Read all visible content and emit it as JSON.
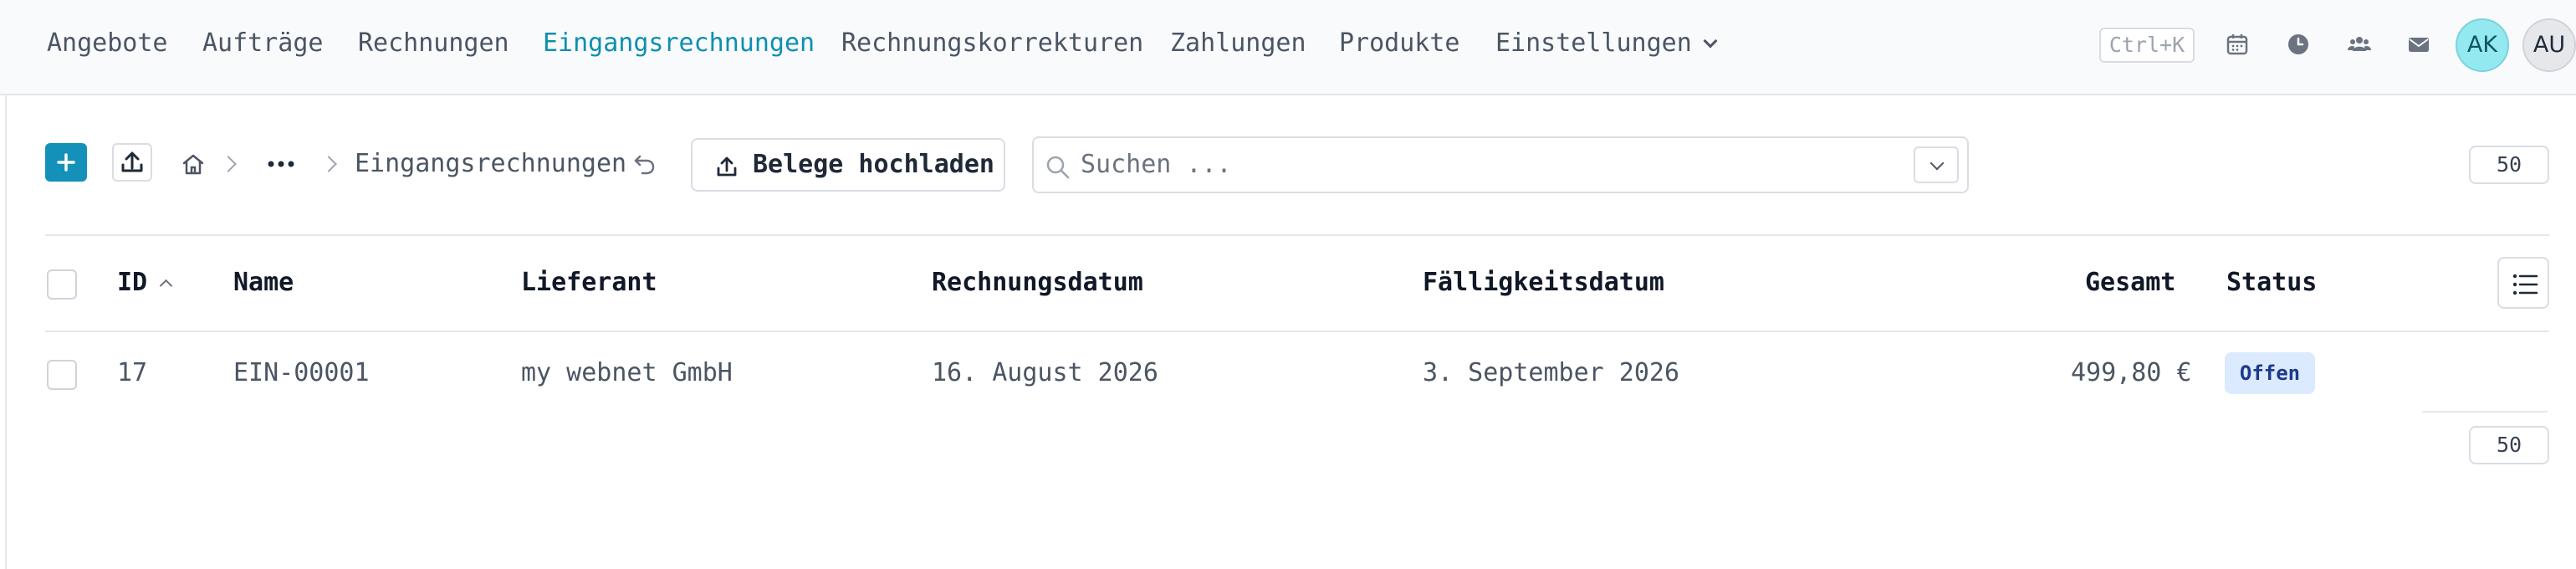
{
  "nav": {
    "items": [
      {
        "label": "Angebote",
        "active": false
      },
      {
        "label": "Aufträge",
        "active": false
      },
      {
        "label": "Rechnungen",
        "active": false
      },
      {
        "label": "Eingangsrechnungen",
        "active": true
      },
      {
        "label": "Rechnungskorrekturen",
        "active": false
      },
      {
        "label": "Zahlungen",
        "active": false
      },
      {
        "label": "Produkte",
        "active": false
      },
      {
        "label": "Einstellungen",
        "active": false
      }
    ],
    "shortcut": "Ctrl+K",
    "icons": [
      "calendar-icon",
      "clock-icon",
      "users-icon",
      "mail-icon"
    ],
    "avatars": [
      "AK",
      "AU"
    ],
    "accent_color": "#0e8fb0"
  },
  "toolbar": {
    "icons": [
      "plus-icon",
      "upload-icon",
      "home-icon",
      "ellipsis-icon",
      "undo-icon"
    ],
    "breadcrumb_current": "Eingangsrechnungen",
    "upload_button_label": "Belege hochladen",
    "search_placeholder": "Suchen ...",
    "page_size": "50"
  },
  "table": {
    "columns": [
      "ID",
      "Name",
      "Lieferant",
      "Rechnungsdatum",
      "Fälligkeitsdatum",
      "Gesamt",
      "Status"
    ],
    "sort": {
      "column": "ID",
      "direction": "ascending"
    },
    "rows": [
      {
        "id": "17",
        "name": "EIN-00001",
        "lieferant": "my webnet GmbH",
        "rechnungsdatum": "16. August 2026",
        "faelligkeitsdatum": "3. September 2026",
        "gesamt": "499,80 €",
        "status": "Offen"
      }
    ],
    "status_color": "#dbeafe",
    "footer_page_size": "50"
  }
}
